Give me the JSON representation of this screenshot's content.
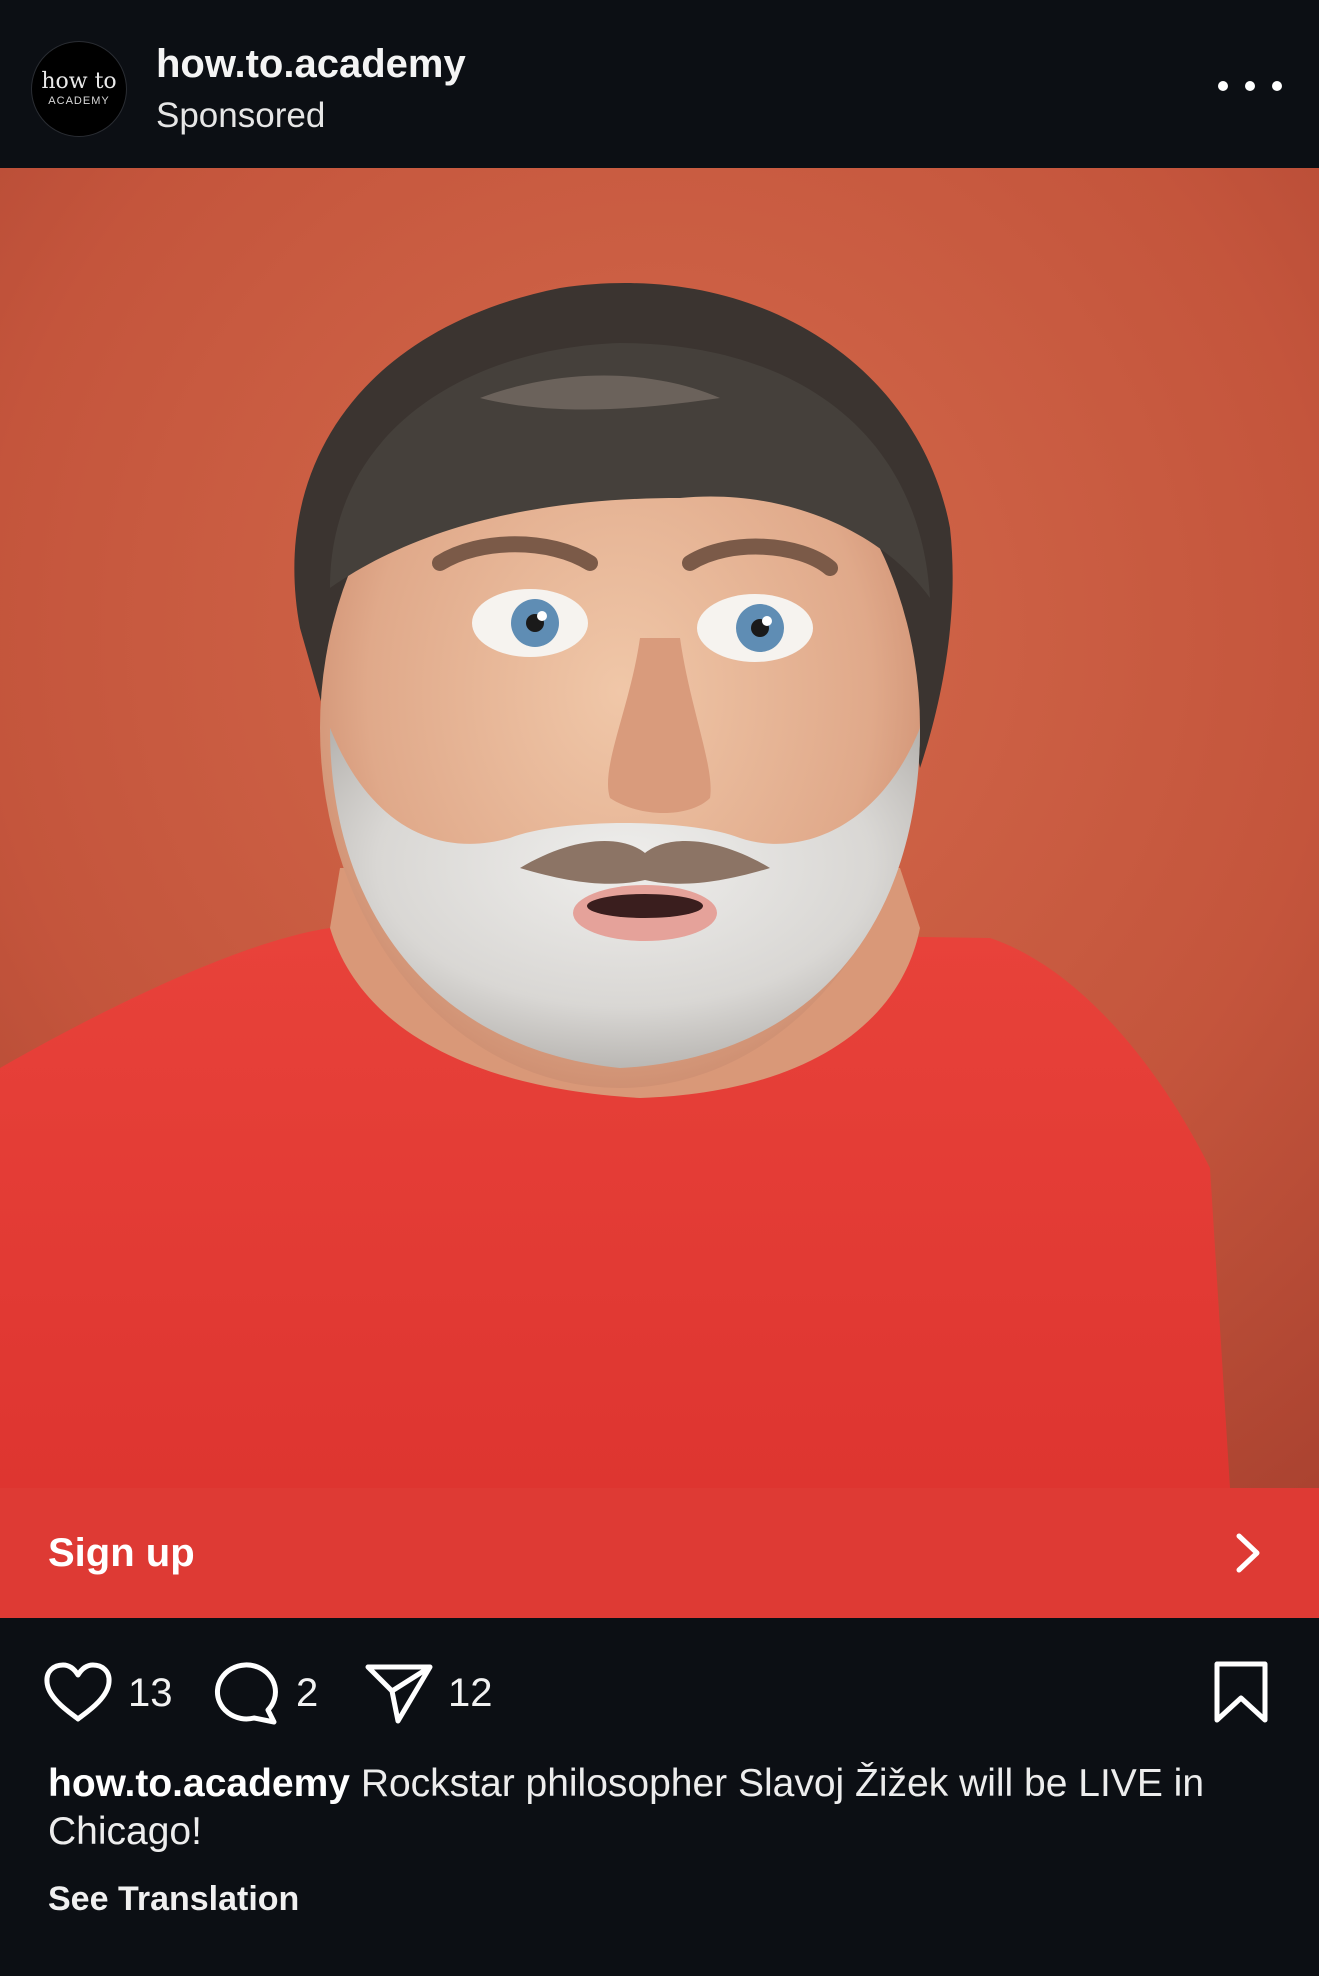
{
  "post": {
    "avatar": {
      "line1": "how to",
      "line2": "ACADEMY"
    },
    "account_name": "how.to.academy",
    "sponsored_label": "Sponsored",
    "more_icon": "more-horizontal-icon"
  },
  "cta": {
    "label": "Sign up",
    "icon": "chevron-right-icon",
    "color": "#de3a34"
  },
  "actions": {
    "likes": {
      "icon": "heart-icon",
      "count": "13"
    },
    "comments": {
      "icon": "comment-icon",
      "count": "2"
    },
    "shares": {
      "icon": "send-icon",
      "count": "12"
    },
    "save": {
      "icon": "bookmark-icon"
    }
  },
  "caption": {
    "username": "how.to.academy",
    "text": "Rockstar philosopher Slavoj Žižek will be LIVE in Chicago!",
    "see_translation": "See Translation"
  },
  "colors": {
    "background": "#0c0f14",
    "photo_backdrop": "#c8553a",
    "shirt": "#e23a33"
  }
}
